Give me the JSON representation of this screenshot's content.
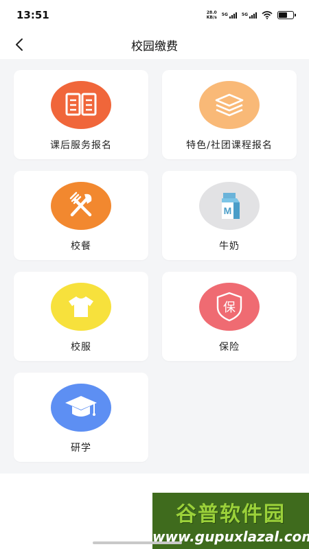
{
  "status": {
    "time": "13:51",
    "net_speed_value": "28.0",
    "net_speed_unit": "KB/s",
    "signal1": "5G",
    "signal2": "5G"
  },
  "nav": {
    "title": "校园缴费"
  },
  "services": [
    {
      "label": "课后服务报名",
      "icon": "book-icon",
      "color": "#F0663A"
    },
    {
      "label": "特色/社团课程报名",
      "icon": "layers-icon",
      "color": "#F9B977"
    },
    {
      "label": "校餐",
      "icon": "utensils-icon",
      "color": "#F2882F"
    },
    {
      "label": "牛奶",
      "icon": "milk-carton-icon",
      "color": "#E2E2E4"
    },
    {
      "label": "校服",
      "icon": "tshirt-icon",
      "color": "#F7E13C"
    },
    {
      "label": "保险",
      "icon": "insurance-shield-icon",
      "color": "#EF6B72"
    },
    {
      "label": "研学",
      "icon": "graduation-cap-icon",
      "color": "#5D8FF3"
    }
  ],
  "insurance_glyph": "保",
  "milk_glyph": "M",
  "watermark": {
    "brand": "谷普软件园",
    "url": "www.gupuxlazal.com"
  }
}
